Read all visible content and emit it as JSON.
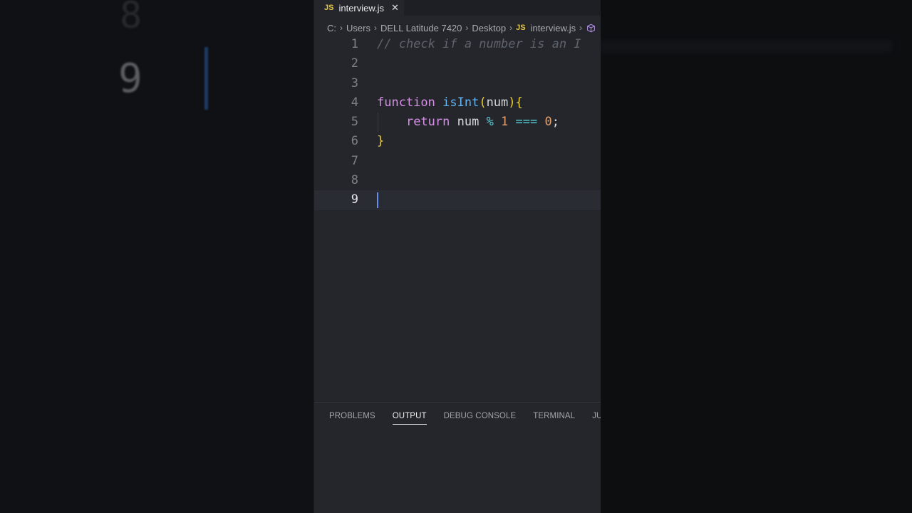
{
  "tab": {
    "badge": "JS",
    "name": "interview.js",
    "close": "✕"
  },
  "breadcrumb": {
    "parts": [
      "C:",
      "Users",
      "DELL Latitude 7420",
      "Desktop"
    ],
    "file_badge": "JS",
    "file": "interview.js"
  },
  "code": {
    "lines": [
      {
        "num": "1",
        "tokens": [
          {
            "t": "comment",
            "v": "// check if a number is an I"
          }
        ]
      },
      {
        "num": "2",
        "tokens": []
      },
      {
        "num": "3",
        "tokens": []
      },
      {
        "num": "4",
        "tokens": [
          {
            "t": "keyword",
            "v": "function "
          },
          {
            "t": "func",
            "v": "isInt"
          },
          {
            "t": "paren",
            "v": "("
          },
          {
            "t": "plain",
            "v": "num"
          },
          {
            "t": "paren",
            "v": ")"
          },
          {
            "t": "brace",
            "v": "{"
          }
        ]
      },
      {
        "num": "5",
        "tokens": [
          {
            "t": "plain",
            "v": "    "
          },
          {
            "t": "keyword",
            "v": "return "
          },
          {
            "t": "plain",
            "v": "num "
          },
          {
            "t": "op",
            "v": "% "
          },
          {
            "t": "num",
            "v": "1 "
          },
          {
            "t": "op",
            "v": "=== "
          },
          {
            "t": "num",
            "v": "0"
          },
          {
            "t": "plain",
            "v": ";"
          }
        ]
      },
      {
        "num": "6",
        "tokens": [
          {
            "t": "brace",
            "v": "}"
          }
        ]
      },
      {
        "num": "7",
        "tokens": []
      },
      {
        "num": "8",
        "tokens": []
      },
      {
        "num": "9",
        "tokens": []
      }
    ],
    "current_line": "9"
  },
  "panel": {
    "tabs": [
      "PROBLEMS",
      "OUTPUT",
      "DEBUG CONSOLE",
      "TERMINAL",
      "JUPYTER"
    ],
    "active_tab": "OUTPUT"
  },
  "background": {
    "numbers": [
      "8",
      "9"
    ]
  },
  "colors": {
    "editor_bg": "#24262c",
    "keyword": "#d690e6",
    "function": "#62b4f0",
    "brace": "#e9cd3a",
    "number": "#e3a06c",
    "operator": "#58d2d8",
    "comment": "#5f636c",
    "caret": "#6a8cf0"
  }
}
